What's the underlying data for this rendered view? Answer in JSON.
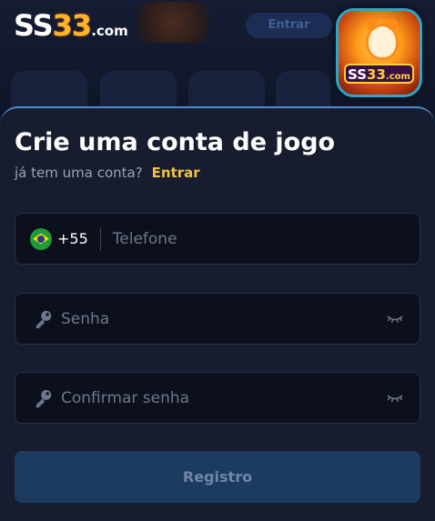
{
  "header": {
    "logo": {
      "ss": "SS",
      "num": "33",
      "dotcom": ".com"
    },
    "app_icon": {
      "badge_ss": "SS",
      "badge_num": "33",
      "badge_com": ".com"
    },
    "bg_pill_text": "Entrar"
  },
  "form": {
    "title": "Crie uma conta de jogo",
    "subtitle": "já tem uma conta?",
    "login_link": "Entrar",
    "phone": {
      "country_code": "+55",
      "placeholder": "Telefone",
      "value": ""
    },
    "password": {
      "placeholder": "Senha",
      "value": ""
    },
    "confirm_password": {
      "placeholder": "Confirmar senha",
      "value": ""
    },
    "submit_label": "Registro"
  },
  "colors": {
    "accent_link": "#f2c14b",
    "panel_border": "#4a8fd6",
    "button_bg": "#1d3a5f"
  },
  "icons": [
    "brazil-flag-icon",
    "key-icon",
    "eye-closed-icon"
  ]
}
